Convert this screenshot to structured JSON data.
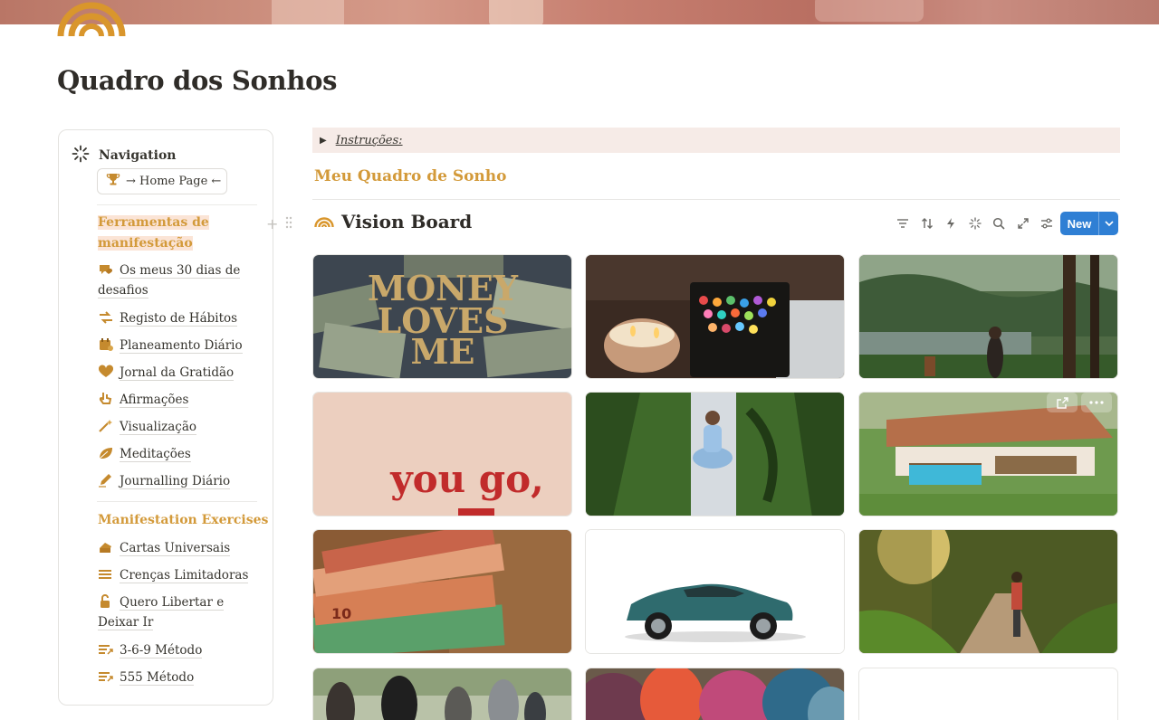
{
  "page": {
    "title": "Quadro dos Sonhos"
  },
  "navigation": {
    "header": "Navigation",
    "home_button": "→ Home Page ←",
    "sections": [
      {
        "title": "Ferramentas de manifestação",
        "items": [
          {
            "label": "Os meus 30 dias de desafios",
            "icon": "chat-heart-icon"
          },
          {
            "label": "Registo de Hábitos",
            "icon": "arrows-icon"
          },
          {
            "label": "Planeamento Diário",
            "icon": "calendar-icon"
          },
          {
            "label": "Jornal da Gratidão",
            "icon": "heart-icon"
          },
          {
            "label": "Afirmações",
            "icon": "hand-icon"
          },
          {
            "label": "Visualização",
            "icon": "magic-wand-icon"
          },
          {
            "label": "Meditações",
            "icon": "leaf-icon"
          },
          {
            "label": "Journalling Diário",
            "icon": "pen-icon"
          }
        ]
      },
      {
        "title": "Manifestation Exercises",
        "items": [
          {
            "label": "Cartas Universais",
            "icon": "cards-icon"
          },
          {
            "label": "Crenças Limitadoras",
            "icon": "list-icon"
          },
          {
            "label": "Quero Libertar e Deixar Ir",
            "icon": "unlock-icon"
          },
          {
            "label": "3-6-9 Método",
            "icon": "list-arrow-icon"
          },
          {
            "label": "555 Método",
            "icon": "list-arrow-icon"
          }
        ]
      }
    ]
  },
  "main": {
    "callout_label": "Instruções:",
    "subheading": "Meu Quadro de Sonho",
    "database": {
      "title": "Vision Board",
      "toolbar_icons": [
        "filter-icon",
        "sort-icon",
        "automation-icon",
        "ai-sparkle-icon",
        "search-icon",
        "expand-icon",
        "settings-icon"
      ],
      "new_button": "New"
    },
    "gallery": [
      {
        "image": "money-loves-me",
        "text": "MONEY LOVES ME"
      },
      {
        "image": "candle-and-markers"
      },
      {
        "image": "woman-in-nature"
      },
      {
        "image": "you-go-girl-quote",
        "text": "you go,"
      },
      {
        "image": "yoga-on-grass"
      },
      {
        "image": "dream-house"
      },
      {
        "image": "euro-banknotes"
      },
      {
        "image": "teal-suv"
      },
      {
        "image": "woman-sunlit-path"
      },
      {
        "image": "friends-hiking"
      },
      {
        "image": "colorful-yarn"
      },
      {
        "image": "empty"
      }
    ]
  },
  "colors": {
    "accent_gold": "#d39a3a",
    "button_blue": "#2f7fd4",
    "callout_bg": "#f6ebe7",
    "highlight": "#fbe4d6"
  }
}
